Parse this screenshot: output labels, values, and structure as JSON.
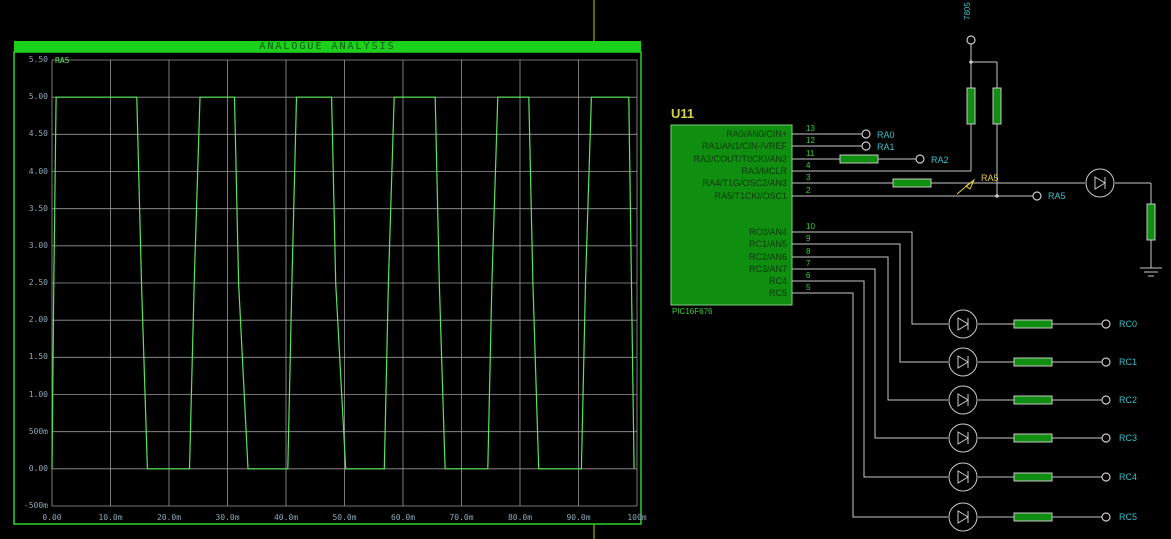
{
  "graph": {
    "title": "ANALOGUE ANALYSIS",
    "trace_name": "RA5",
    "y_ticks": [
      "5.50",
      "5.00",
      "4.50",
      "4.00",
      "3.50",
      "3.00",
      "2.50",
      "2.00",
      "1.50",
      "1.00",
      "500m",
      "0.00",
      "-500m"
    ],
    "x_ticks": [
      "0.00",
      "10.0m",
      "20.0m",
      "30.0m",
      "40.0m",
      "50.0m",
      "60.0m",
      "70.0m",
      "80.0m",
      "90.0m",
      "100m"
    ],
    "colors": {
      "title_bar": "#1cd11c",
      "trace": "#57e657",
      "grid": "#9a9a9a",
      "frame": "#2ad32a"
    }
  },
  "chart_data": {
    "type": "line",
    "title": "ANALOGUE ANALYSIS",
    "xlabel": "",
    "ylabel": "",
    "xlim": [
      0,
      0.1
    ],
    "ylim": [
      -0.5,
      5.5
    ],
    "series": [
      {
        "name": "RA5",
        "x": [
          0.0,
          0.0003,
          0.0007,
          0.0145,
          0.0153,
          0.0163,
          0.0235,
          0.0243,
          0.0253,
          0.0312,
          0.0319,
          0.0335,
          0.0403,
          0.041,
          0.0418,
          0.0478,
          0.0485,
          0.0502,
          0.0568,
          0.0575,
          0.0585,
          0.0655,
          0.0662,
          0.0672,
          0.0745,
          0.0752,
          0.0762,
          0.0815,
          0.0822,
          0.0832,
          0.0905,
          0.0912,
          0.0922,
          0.0986,
          0.0995
        ],
        "y": [
          0.0,
          2.5,
          5.0,
          5.0,
          2.5,
          0.0,
          0.0,
          2.5,
          5.0,
          5.0,
          2.5,
          0.0,
          0.0,
          2.5,
          5.0,
          5.0,
          2.5,
          0.0,
          0.0,
          2.5,
          5.0,
          5.0,
          2.5,
          0.0,
          0.0,
          2.5,
          5.0,
          5.0,
          2.5,
          0.0,
          0.0,
          2.5,
          5.0,
          5.0,
          0.0
        ]
      }
    ]
  },
  "chip": {
    "name": "U11",
    "part": "PIC16F676",
    "left_pins": [
      {
        "label": "RA0/AN0/CIN+",
        "num": "13"
      },
      {
        "label": "RA1/AN1/CIN-/VREF",
        "num": "12"
      },
      {
        "label": "RA2/COUT/T0CKI/AN2",
        "num": "11"
      },
      {
        "label": "RA3/MCLR",
        "num": "4"
      },
      {
        "label": "RA4/T1G/OSC2/AN3",
        "num": "3"
      },
      {
        "label": "RA5/T1CKI/OSC1",
        "num": "2"
      },
      {
        "label": "RC0/AN4",
        "num": "10"
      },
      {
        "label": "RC1/AN5",
        "num": "9"
      },
      {
        "label": "RC2/AN6",
        "num": "8"
      },
      {
        "label": "RC3/AN7",
        "num": "7"
      },
      {
        "label": "RC4",
        "num": "6"
      },
      {
        "label": "RC5",
        "num": "5"
      }
    ]
  },
  "ports": {
    "ra0": "RA0",
    "ra1": "RA1",
    "ra2": "RA2",
    "ra5": "RA5",
    "rc": [
      "RC0",
      "RC1",
      "RC2",
      "RC3",
      "RC4",
      "RC5"
    ]
  },
  "probe": "RA5",
  "regulator": "7805"
}
